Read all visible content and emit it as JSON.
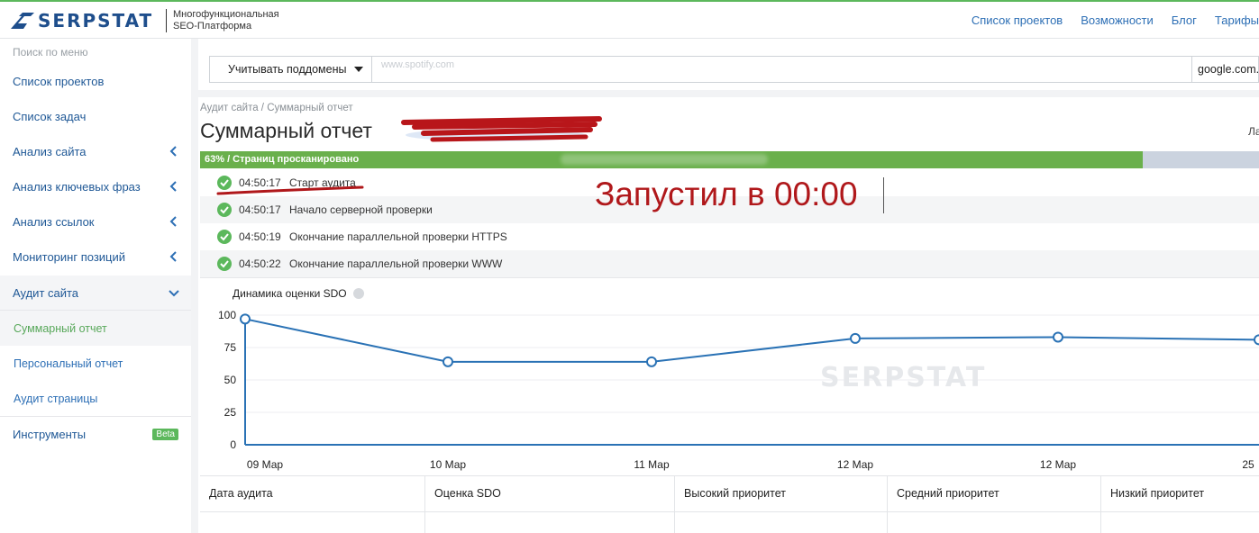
{
  "header": {
    "brand": "SERPSTAT",
    "tagline_line1": "Многофункциональная",
    "tagline_line2": "SEO-Платформа",
    "nav": [
      "Список проектов",
      "Возможности",
      "Блог",
      "Тарифы"
    ]
  },
  "sidebar": {
    "search_placeholder": "Поиск по меню",
    "items": [
      {
        "label": "Список проектов"
      },
      {
        "label": "Список задач"
      },
      {
        "label": "Анализ сайта"
      },
      {
        "label": "Анализ ключевых фраз"
      },
      {
        "label": "Анализ ссылок"
      },
      {
        "label": "Мониторинг позиций"
      },
      {
        "label": "Аудит сайта"
      },
      {
        "label": "Суммарный отчет"
      },
      {
        "label": "Персональный отчет"
      },
      {
        "label": "Аудит страницы"
      },
      {
        "label": "Инструменты"
      }
    ],
    "beta_badge": "Beta"
  },
  "searchbar": {
    "subdomains_label": "Учитывать поддомены",
    "domain_value": "www.spotify.com",
    "engine": "google.com."
  },
  "breadcrumb": "Аудит сайта / Суммарный отчет",
  "page_title": "Суммарный отчет",
  "right_cut_text": "Ла",
  "progress": {
    "percent": 63,
    "text": "63% / Страниц просканировано"
  },
  "log": [
    {
      "time": "04:50:17",
      "message": "Старт аудита"
    },
    {
      "time": "04:50:17",
      "message": "Начало серверной проверки"
    },
    {
      "time": "04:50:19",
      "message": "Окончание параллельной проверки HTTPS"
    },
    {
      "time": "04:50:22",
      "message": "Окончание параллельной проверки WWW"
    }
  ],
  "annotation": "Запустил в 00:00",
  "colors": {
    "brand_blue": "#1e4e8c",
    "link_blue": "#2d6fb5",
    "green": "#5cb85c",
    "annotation_red": "#b0181b",
    "line_blue": "#2a72b5"
  },
  "chart_data": {
    "type": "line",
    "title": "Динамика оценки SDO",
    "categories": [
      "09 Мар",
      "10 Мар",
      "11 Мар",
      "12 Мар",
      "12 Мар",
      "25"
    ],
    "series": [
      {
        "values": [
          97,
          64,
          64,
          82,
          83,
          81
        ]
      }
    ],
    "yticks": [
      100,
      75,
      50,
      25,
      0
    ],
    "ylim": [
      0,
      100
    ],
    "watermark": "SERPSTAT",
    "grid": true
  },
  "table": {
    "headers": [
      "Дата аудита",
      "Оценка SDO",
      "Высокий приоритет",
      "Средний приоритет",
      "Низкий приоритет"
    ]
  }
}
